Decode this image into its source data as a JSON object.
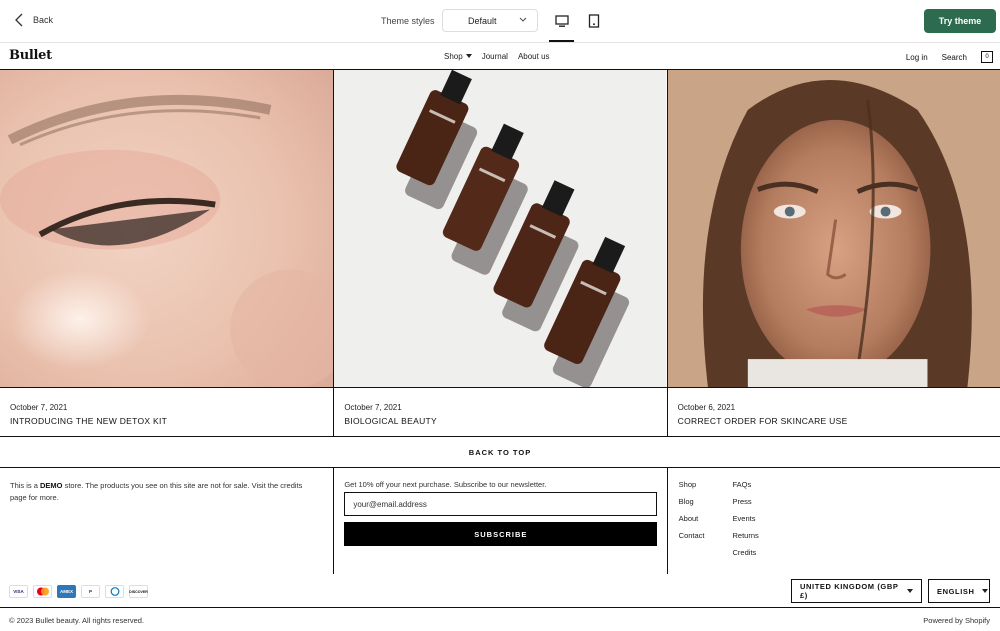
{
  "toolbar": {
    "back_label": "Back",
    "styles_label": "Theme styles",
    "style_selected": "Default",
    "try_label": "Try theme",
    "accent_color": "#2d6b4e"
  },
  "store": {
    "logo": "Bullet",
    "nav": {
      "shop": "Shop",
      "journal": "Journal",
      "about": "About us"
    },
    "login": "Log in",
    "search": "Search",
    "cart_count": "0"
  },
  "posts": [
    {
      "date": "October 7, 2021",
      "title": "INTRODUCING THE NEW DETOX KIT"
    },
    {
      "date": "October 7, 2021",
      "title": "BIOLOGICAL BEAUTY"
    },
    {
      "date": "October 6, 2021",
      "title": "CORRECT ORDER FOR SKINCARE USE"
    }
  ],
  "back_to_top": "BACK TO TOP",
  "footer": {
    "demo_prefix": "This is a ",
    "demo_bold": "DEMO",
    "demo_suffix": " store. The products you see on this site are not for sale. Visit the credits page for more.",
    "newsletter_text": "Get 10% off your next purchase. Subscribe to our newsletter.",
    "email_placeholder": "your@email.address",
    "subscribe_label": "SUBSCRIBE",
    "links_col1": [
      "Shop",
      "Blog",
      "About",
      "Contact"
    ],
    "links_col2": [
      "FAQs",
      "Press",
      "Events",
      "Returns",
      "Credits"
    ]
  },
  "payments": [
    "VISA",
    "MC",
    "AMEX",
    "PayPal",
    "Diners",
    "DISCOVER"
  ],
  "locale": {
    "country": "UNITED KINGDOM (GBP £)",
    "language": "ENGLISH"
  },
  "copyright": "© 2023 Bullet beauty. All rights reserved.",
  "powered": "Powered by Shopify"
}
